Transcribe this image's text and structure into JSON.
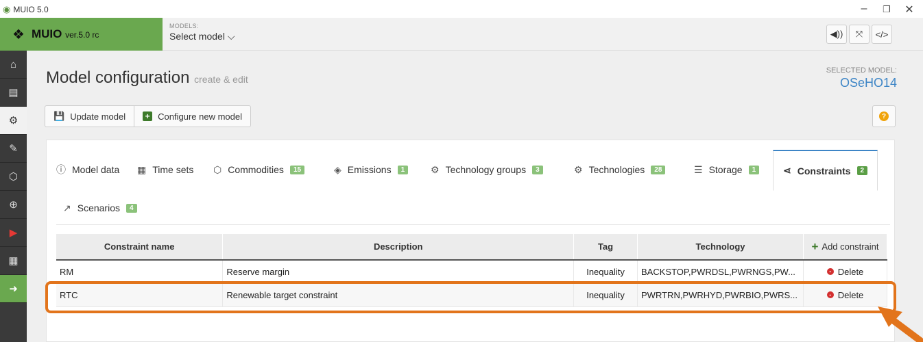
{
  "window": {
    "title": "MUIO 5.0",
    "controls": [
      "–",
      "❐",
      "✕"
    ]
  },
  "brand": {
    "name": "MUIO",
    "version": "ver.5.0 rc"
  },
  "models": {
    "label": "MODELS:",
    "selected": "Select model ⌵"
  },
  "topbar_buttons": [
    "◀))",
    "⤧",
    "</>"
  ],
  "sidebar": [
    "home-icon",
    "file-icon",
    "cogs-icon",
    "edit-icon",
    "network-icon",
    "zoom-icon",
    "run-icon",
    "table-icon",
    "next-icon"
  ],
  "page": {
    "title": "Model configuration",
    "subtitle": "create & edit"
  },
  "selected_model": {
    "label": "SELECTED MODEL:",
    "value": "OSeHO14"
  },
  "toolbar": {
    "update": "Update model",
    "configure": "Configure new model",
    "help": "?"
  },
  "tabs": [
    {
      "label": "Model data",
      "badge": ""
    },
    {
      "label": "Time sets",
      "badge": ""
    },
    {
      "label": "Commodities",
      "badge": "15"
    },
    {
      "label": "Emissions",
      "badge": "1"
    },
    {
      "label": "Technology groups",
      "badge": "3"
    },
    {
      "label": "Technologies",
      "badge": "28"
    },
    {
      "label": "Storage",
      "badge": "1"
    },
    {
      "label": "Constraints",
      "badge": "2"
    },
    {
      "label": "Scenarios",
      "badge": "4"
    }
  ],
  "table": {
    "headers": [
      "Constraint name",
      "Description",
      "Tag",
      "Technology"
    ],
    "add_label": "Add constraint",
    "rows": [
      {
        "name": "RM",
        "description": "Reserve margin",
        "tag": "Inequality",
        "technology": "BACKSTOP,PWRDSL,PWRNGS,PW...",
        "action": "Delete"
      },
      {
        "name": "RTC",
        "description": "Renewable target constraint",
        "tag": "Inequality",
        "technology": "PWRTRN,PWRHYD,PWRBIO,PWRS...",
        "action": "Delete"
      }
    ]
  },
  "colors": {
    "brand": "#6aa84f",
    "accent": "#3d85c6",
    "highlight": "#e2741b",
    "badge": "#8bc27a",
    "delete": "#d32f2f"
  }
}
